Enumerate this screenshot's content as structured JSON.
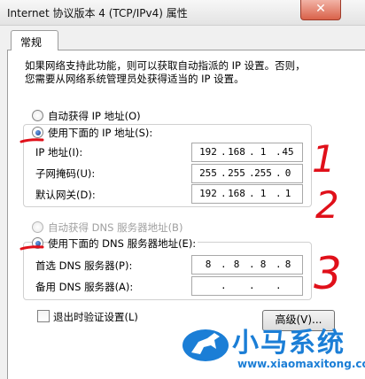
{
  "window": {
    "title": "Internet 协议版本 4 (TCP/IPv4) 属性",
    "close_label": "✕"
  },
  "tabs": [
    {
      "label": "常规"
    }
  ],
  "description": {
    "line1": "如果网络支持此功能，则可以获取自动指派的 IP 设置。否则，",
    "line2": "您需要从网络系统管理员处获得适当的 IP 设置。"
  },
  "ip": {
    "auto_label": "自动获得 IP 地址(O)",
    "manual_label": "使用下面的 IP 地址(S):",
    "selected": "manual",
    "address_label": "IP 地址(I):",
    "address": [
      "192",
      "168",
      "1",
      "45"
    ],
    "subnet_label": "子网掩码(U):",
    "subnet": [
      "255",
      "255",
      "255",
      "0"
    ],
    "gateway_label": "默认网关(D):",
    "gateway": [
      "192",
      "168",
      "1",
      "1"
    ]
  },
  "dns": {
    "auto_label": "自动获得 DNS 服务器地址(B)",
    "manual_label": "使用下面的 DNS 服务器地址(E):",
    "selected": "manual",
    "preferred_label": "首选 DNS 服务器(P):",
    "preferred": [
      "8",
      "8",
      "8",
      "8"
    ],
    "alternate_label": "备用 DNS 服务器(A):",
    "alternate": [
      "",
      "",
      "",
      ""
    ]
  },
  "validate_on_exit": {
    "label": "退出时验证设置(L)",
    "checked": false
  },
  "advanced_button": {
    "label": "高级(V)..."
  },
  "annotations": [
    "1",
    "2",
    "3"
  ],
  "watermark": {
    "brand": "小马系统",
    "url": "www.xiaomaxitong.com"
  },
  "colors": {
    "annotation": "#e0101a",
    "watermark": "#1b7ed6",
    "selected_radio": "#1a4fa8"
  }
}
